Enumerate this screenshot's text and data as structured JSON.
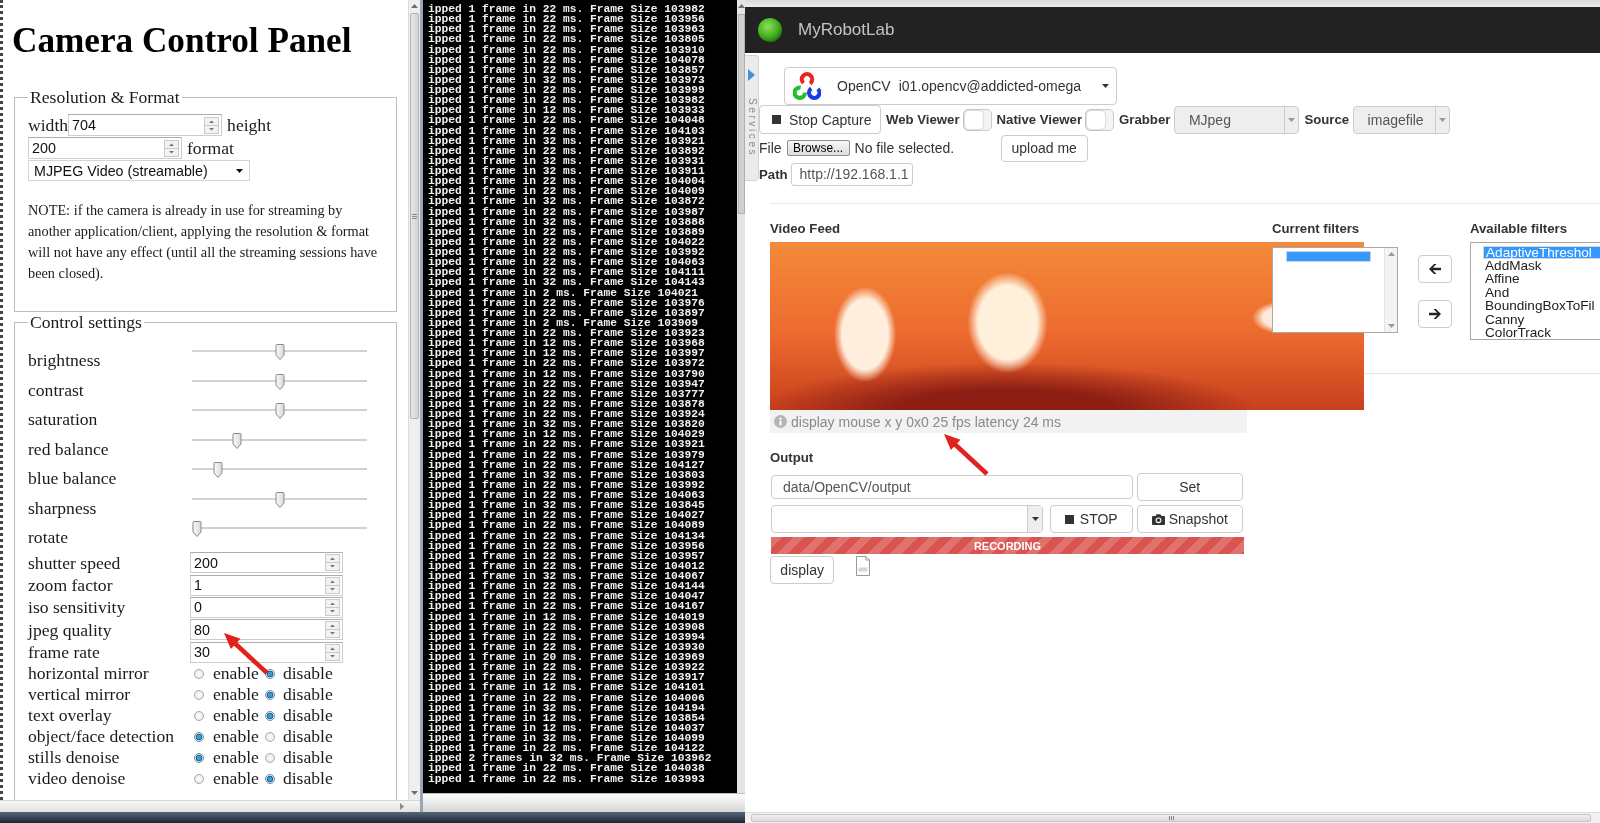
{
  "camera_panel": {
    "title": "Camera Control Panel",
    "resolution_format": {
      "legend": "Resolution & Format",
      "width_label": "width",
      "width_value": "704",
      "height_label": "height",
      "height_value": "200",
      "format_label": "format",
      "format_value": "MJPEG Video (streamable)",
      "note": "NOTE: if the camera is already in use for streaming by another application/client, applying the resolution & format will not have any effect (until all the streaming sessions have been closed)."
    },
    "control_settings": {
      "legend": "Control settings",
      "sliders": [
        {
          "label": "brightness",
          "level": 0.5
        },
        {
          "label": "contrast",
          "level": 0.5
        },
        {
          "label": "saturation",
          "level": 0.5
        },
        {
          "label": "red balance",
          "level": 0.24
        },
        {
          "label": "blue balance",
          "level": 0.13
        },
        {
          "label": "sharpness",
          "level": 0.5
        },
        {
          "label": "rotate",
          "level": 0
        }
      ],
      "number_fields": [
        {
          "label": "shutter speed",
          "value": "200",
          "annotated": false
        },
        {
          "label": "zoom factor",
          "value": "1",
          "annotated": false
        },
        {
          "label": "iso sensitivity",
          "value": "0",
          "annotated": false
        },
        {
          "label": "jpeg quality",
          "value": "80",
          "annotated": true
        },
        {
          "label": "frame rate",
          "value": "30",
          "annotated": false
        }
      ],
      "radio_rows": [
        {
          "label": "horizontal mirror",
          "options": [
            {
              "label": "enable",
              "selected": false
            },
            {
              "label": "disable",
              "selected": true
            }
          ]
        },
        {
          "label": "vertical mirror",
          "options": [
            {
              "label": "enable",
              "selected": false
            },
            {
              "label": "disable",
              "selected": true
            }
          ]
        },
        {
          "label": "text overlay",
          "options": [
            {
              "label": "enable",
              "selected": false
            },
            {
              "label": "disable",
              "selected": true
            }
          ]
        },
        {
          "label": "object/face detection",
          "options": [
            {
              "label": "enable",
              "selected": true
            },
            {
              "label": "disable",
              "selected": false
            }
          ]
        },
        {
          "label": "stills denoise",
          "options": [
            {
              "label": "enable",
              "selected": true
            },
            {
              "label": "disable",
              "selected": false
            }
          ]
        },
        {
          "label": "video denoise",
          "options": [
            {
              "label": "enable",
              "selected": false
            },
            {
              "label": "disable",
              "selected": true
            }
          ]
        }
      ]
    }
  },
  "console": {
    "lines": [
      "ipped 1 frame in 22 ms. Frame Size 103982",
      "ipped 1 frame in 22 ms. Frame Size 103956",
      "ipped 1 frame in 22 ms. Frame Size 103963",
      "ipped 1 frame in 22 ms. Frame Size 103805",
      "ipped 1 frame in 22 ms. Frame Size 103910",
      "ipped 1 frame in 22 ms. Frame Size 104078",
      "ipped 1 frame in 22 ms. Frame Size 103857",
      "ipped 1 frame in 32 ms. Frame Size 103973",
      "ipped 1 frame in 22 ms. Frame Size 103999",
      "ipped 1 frame in 22 ms. Frame Size 103982",
      "ipped 1 frame in 12 ms. Frame Size 103933",
      "ipped 1 frame in 22 ms. Frame Size 104048",
      "ipped 1 frame in 22 ms. Frame Size 104103",
      "ipped 1 frame in 32 ms. Frame Size 103921",
      "ipped 1 frame in 22 ms. Frame Size 103892",
      "ipped 1 frame in 32 ms. Frame Size 103931",
      "ipped 1 frame in 32 ms. Frame Size 103911",
      "ipped 1 frame in 22 ms. Frame Size 104004",
      "ipped 1 frame in 22 ms. Frame Size 104009",
      "ipped 1 frame in 32 ms. Frame Size 103872",
      "ipped 1 frame in 22 ms. Frame Size 103987",
      "ipped 1 frame in 32 ms. Frame Size 103888",
      "ipped 1 frame in 22 ms. Frame Size 103889",
      "ipped 1 frame in 22 ms. Frame Size 104022",
      "ipped 1 frame in 22 ms. Frame Size 103992",
      "ipped 1 frame in 22 ms. Frame Size 104063",
      "ipped 1 frame in 22 ms. Frame Size 104111",
      "ipped 1 frame in 32 ms. Frame Size 104143",
      "ipped 1 frame in 2 ms. Frame Size 104021",
      "ipped 1 frame in 22 ms. Frame Size 103976",
      "ipped 1 frame in 22 ms. Frame Size 103897",
      "ipped 1 frame in 2 ms. Frame Size 103909",
      "ipped 1 frame in 22 ms. Frame Size 103923",
      "ipped 1 frame in 12 ms. Frame Size 103968",
      "ipped 1 frame in 12 ms. Frame Size 103997",
      "ipped 1 frame in 22 ms. Frame Size 103972",
      "ipped 1 frame in 12 ms. Frame Size 103790",
      "ipped 1 frame in 22 ms. Frame Size 103947",
      "ipped 1 frame in 22 ms. Frame Size 103777",
      "ipped 1 frame in 22 ms. Frame Size 103878",
      "ipped 1 frame in 22 ms. Frame Size 103924",
      "ipped 1 frame in 32 ms. Frame Size 103820",
      "ipped 1 frame in 12 ms. Frame Size 104029",
      "ipped 1 frame in 22 ms. Frame Size 103921",
      "ipped 1 frame in 22 ms. Frame Size 103979",
      "ipped 1 frame in 22 ms. Frame Size 104127",
      "ipped 1 frame in 32 ms. Frame Size 103803",
      "ipped 1 frame in 22 ms. Frame Size 103992",
      "ipped 1 frame in 22 ms. Frame Size 104063",
      "ipped 1 frame in 32 ms. Frame Size 103845",
      "ipped 1 frame in 22 ms. Frame Size 104027",
      "ipped 1 frame in 22 ms. Frame Size 104089",
      "ipped 1 frame in 22 ms. Frame Size 104134",
      "ipped 1 frame in 22 ms. Frame Size 103956",
      "ipped 1 frame in 22 ms. Frame Size 103957",
      "ipped 1 frame in 22 ms. Frame Size 104012",
      "ipped 1 frame in 32 ms. Frame Size 104067",
      "ipped 1 frame in 22 ms. Frame Size 104144",
      "ipped 1 frame in 22 ms. Frame Size 104047",
      "ipped 1 frame in 22 ms. Frame Size 104167",
      "ipped 1 frame in 12 ms. Frame Size 104019",
      "ipped 1 frame in 22 ms. Frame Size 103908",
      "ipped 1 frame in 22 ms. Frame Size 103994",
      "ipped 1 frame in 22 ms. Frame Size 103930",
      "ipped 1 frame in 20 ms. Frame Size 103969",
      "ipped 1 frame in 22 ms. Frame Size 103922",
      "ipped 1 frame in 22 ms. Frame Size 103917",
      "ipped 1 frame in 12 ms. Frame Size 104101",
      "ipped 1 frame in 22 ms. Frame Size 104006",
      "ipped 1 frame in 32 ms. Frame Size 104194",
      "ipped 1 frame in 12 ms. Frame Size 103854",
      "ipped 1 frame in 12 ms. Frame Size 104037",
      "ipped 1 frame in 32 ms. Frame Size 104099",
      "ipped 1 frame in 22 ms. Frame Size 104122",
      "ipped 2 frames in 32 ms. Frame Size 103962",
      "ipped 1 frame in 22 ms. Frame Size 104038",
      "ipped 1 frame in 22 ms. Frame Size 103993"
    ]
  },
  "robot_lab": {
    "app_title": "MyRobotLab",
    "services_tab": "Services",
    "service": {
      "type": "OpenCV",
      "name": "i01.opencv@addicted-omega"
    },
    "toolbar": {
      "stop_button": "Stop Capture",
      "switches": [
        {
          "label": "Web Viewer",
          "on": false
        },
        {
          "label": "Native Viewer",
          "on": false
        }
      ],
      "selects": [
        {
          "label": "Grabber",
          "value": "MJpeg"
        },
        {
          "label": "Source",
          "value": "imagefile"
        }
      ]
    },
    "file": {
      "label": "File",
      "browse_button": "Browse...",
      "status": "No file selected.",
      "upload_button": "upload me"
    },
    "path": {
      "label": "Path",
      "value": "http://192.168.1.1"
    },
    "video_feed": {
      "heading": "Video Feed",
      "stats": "display mouse x y 0x0 25 fps latency 24 ms",
      "annotated": true
    },
    "current_filters": {
      "heading": "Current filters",
      "items": [
        {
          "selected": true
        }
      ]
    },
    "available_filters": {
      "heading": "Available filters",
      "items": [
        {
          "label": "AdaptiveThreshol",
          "selected": true
        },
        {
          "label": "AddMask",
          "selected": false
        },
        {
          "label": "Affine",
          "selected": false
        },
        {
          "label": "And",
          "selected": false
        },
        {
          "label": "BoundingBoxToFil",
          "selected": false
        },
        {
          "label": "Canny",
          "selected": false
        },
        {
          "label": "ColorTrack",
          "selected": false
        }
      ]
    },
    "output": {
      "heading": "Output",
      "path_value": "data/OpenCV/output",
      "set_button": "Set",
      "stop_button": "STOP",
      "snapshot_button": "Snapshot",
      "recording_label": "RECORDING",
      "display_button": "display"
    }
  }
}
